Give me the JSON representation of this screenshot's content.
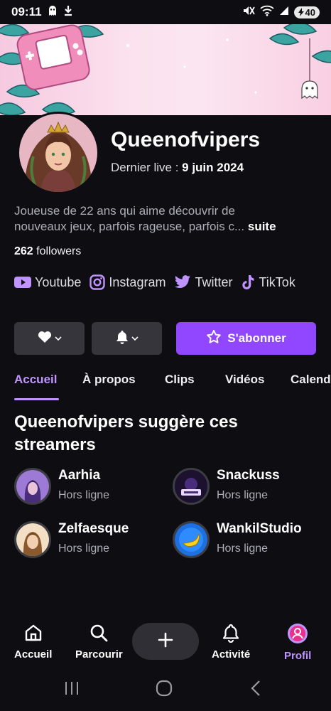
{
  "status_bar": {
    "time": "09:11",
    "battery": "40"
  },
  "profile": {
    "channel_name": "Queenofvipers",
    "last_live_label": "Dernier live : ",
    "last_live_date": "9 juin 2024",
    "bio_line1": "Joueuse de 22 ans qui aime découvrir de",
    "bio_line2": "nouveaux jeux, parfois rageuse, parfois c...",
    "bio_more": "suite",
    "followers_count": "262",
    "followers_label": "followers"
  },
  "socials": [
    {
      "label": "Youtube",
      "icon": "youtube-icon"
    },
    {
      "label": "Instagram",
      "icon": "instagram-icon"
    },
    {
      "label": "Twitter",
      "icon": "twitter-icon"
    },
    {
      "label": "TikTok",
      "icon": "tiktok-icon"
    }
  ],
  "actions": {
    "subscribe_label": "S'abonner"
  },
  "tabs": [
    {
      "label": "Accueil",
      "active": true
    },
    {
      "label": "À propos"
    },
    {
      "label": "Clips"
    },
    {
      "label": "Vidéos"
    },
    {
      "label": "Calend"
    }
  ],
  "suggestions": {
    "title": "Queenofvipers suggère ces streamers",
    "streamers": [
      {
        "name": "Aarhia",
        "status": "Hors ligne"
      },
      {
        "name": "Snackuss",
        "status": "Hors ligne"
      },
      {
        "name": "Zelfaesque",
        "status": "Hors ligne"
      },
      {
        "name": "WankilStudio",
        "status": "Hors ligne"
      }
    ]
  },
  "bottom_nav": [
    {
      "label": "Accueil",
      "icon": "home-icon"
    },
    {
      "label": "Parcourir",
      "icon": "search-icon"
    },
    {
      "label": "Activité",
      "icon": "bell-icon"
    },
    {
      "label": "Profil",
      "icon": "profile-icon",
      "active": true
    }
  ],
  "colors": {
    "accent": "#9147ff",
    "accent_light": "#bf94ff",
    "background": "#0e0e12",
    "button_dark": "#35353b"
  }
}
